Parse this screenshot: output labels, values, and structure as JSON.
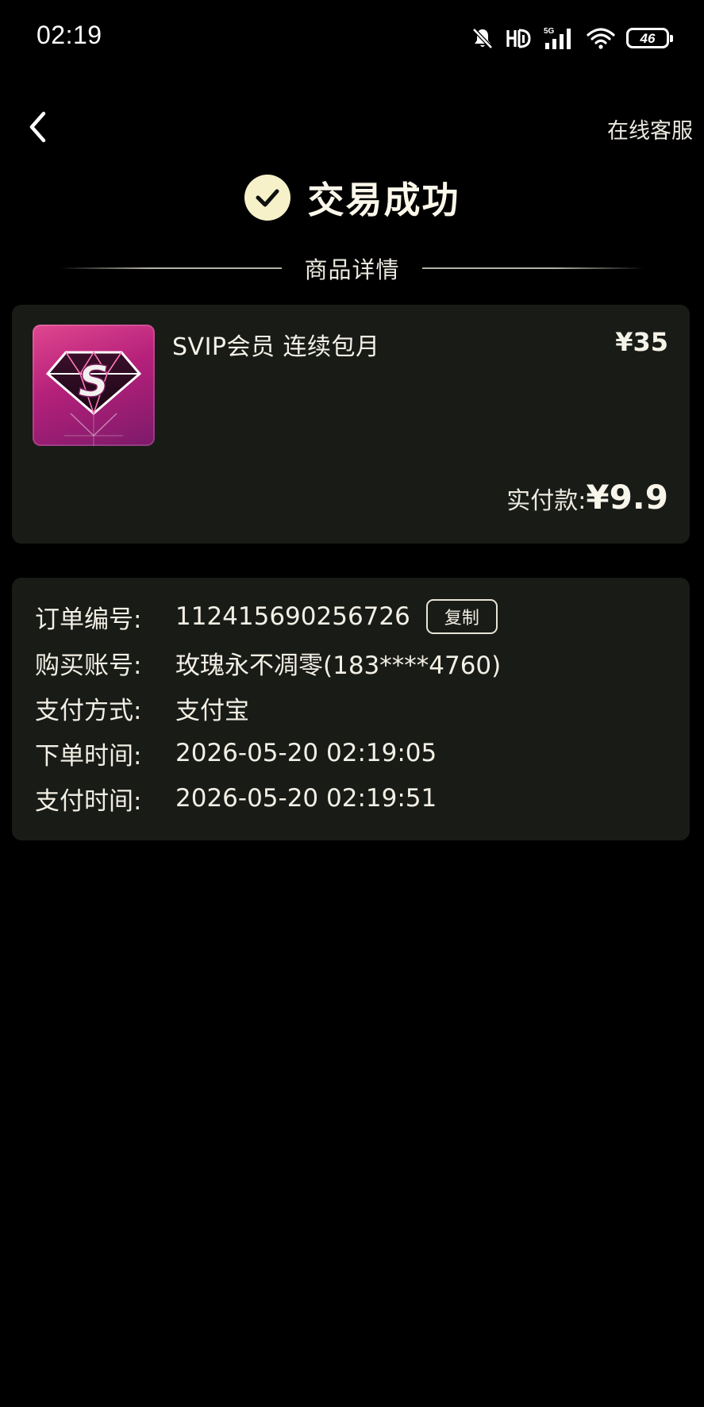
{
  "status_bar": {
    "time": "02:19",
    "battery_level": "46",
    "network_label": "5G",
    "icons": [
      "bell-off-icon",
      "hd-icon",
      "signal-icon",
      "wifi-icon",
      "battery-icon"
    ]
  },
  "nav": {
    "back_icon": "chevron-left-icon",
    "support_label": "在线客服"
  },
  "header": {
    "status_icon": "check-circle-icon",
    "title": "交易成功"
  },
  "section": {
    "title": "商品详情"
  },
  "product": {
    "name": "SVIP会员 连续包月",
    "price": "¥35",
    "paid_label": "实付款:",
    "paid_amount": "¥9.9",
    "thumb_letter": "S"
  },
  "order": {
    "rows": [
      {
        "label": "订单编号:",
        "value": "112415690256726"
      },
      {
        "label": "购买账号:",
        "value": "玫瑰永不凋零(183****4760)"
      },
      {
        "label": "支付方式:",
        "value": "支付宝"
      },
      {
        "label": "下单时间:",
        "value": "2026-05-20 02:19:05"
      },
      {
        "label": "支付时间:",
        "value": "2026-05-20 02:19:51"
      }
    ],
    "copy_label": "复制"
  },
  "colors": {
    "background": "#000000",
    "card": "#191b17",
    "accent_check": "#f6f1c9",
    "thumb_gradient_start": "#e0478f",
    "thumb_gradient_end": "#7c1a6a"
  }
}
